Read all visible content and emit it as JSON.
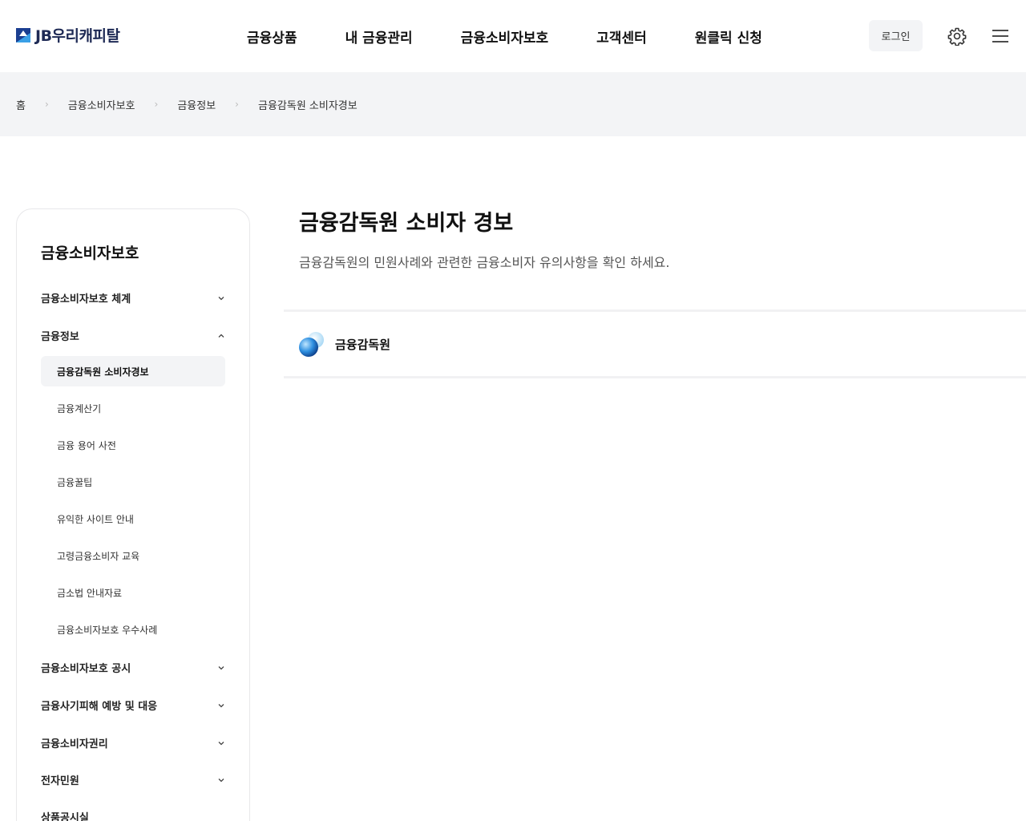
{
  "header": {
    "logo_text": "JB우리캐피탈",
    "nav": [
      "금융상품",
      "내 금융관리",
      "금융소비자보호",
      "고객센터",
      "원클릭 신청"
    ],
    "login_label": "로그인"
  },
  "breadcrumb": [
    "홈",
    "금융소비자보호",
    "금융정보",
    "금융감독원 소비자경보"
  ],
  "breadcrumb_sep": "›",
  "sidebar": {
    "title": "금융소비자보호",
    "items": [
      {
        "label": "금융소비자보호 체계",
        "expanded": false
      },
      {
        "label": "금융정보",
        "expanded": true
      },
      {
        "label": "금융소비자보호 공시",
        "expanded": false
      },
      {
        "label": "금융사기피해 예방 및 대응",
        "expanded": false
      },
      {
        "label": "금융소비자권리",
        "expanded": false
      },
      {
        "label": "전자민원",
        "expanded": false
      },
      {
        "label": "상품공시실",
        "expanded": false
      }
    ],
    "subitems": [
      "금융감독원 소비자경보",
      "금융계산기",
      "금융 용어 사전",
      "금융꿀팁",
      "유익한 사이트 안내",
      "고령금융소비자 교육",
      "금소법 안내자료",
      "금융소비자보호 우수사례"
    ],
    "active_subitem": 0
  },
  "main": {
    "title": "금융감독원 소비자 경보",
    "description": "금융감독원의 민원사례와 관련한 금융소비자 유의사항을 확인 하세요.",
    "org_name": "금융감독원"
  },
  "colors": {
    "brand_navy": "#1b3f91",
    "brand_sky": "#3aa0e6",
    "panel_bg": "#f3f4f6"
  }
}
